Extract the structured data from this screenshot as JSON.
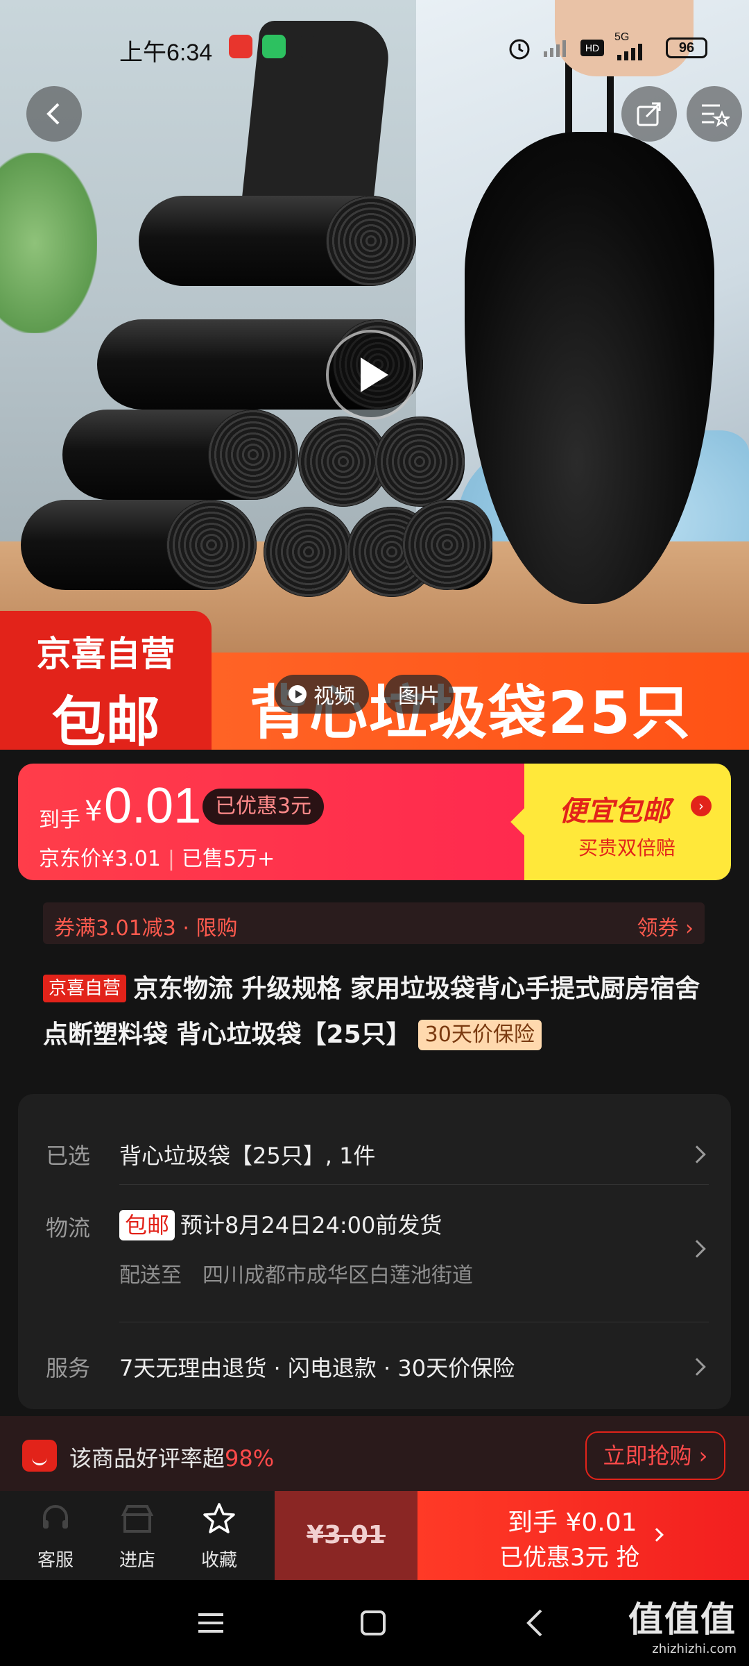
{
  "status_bar": {
    "time": "上午6:34",
    "network": "5G",
    "battery": "96"
  },
  "hero": {
    "badge_line1": "京喜自营",
    "badge_line2": "包邮",
    "banner_text": "背心垃圾袋25只",
    "tab_video": "视频",
    "tab_images": "图片"
  },
  "price": {
    "daoshou_label": "到手",
    "currency": "¥",
    "amount": "0.01",
    "saved": "已优惠3元",
    "jd_price": "京东价¥3.01",
    "sold": "已售5万+",
    "promo_title": "便宜包邮",
    "promo_sub": "买贵双倍赔"
  },
  "coupon": {
    "text": "券满3.01减3 · 限购",
    "action": "领券 ›"
  },
  "product": {
    "tag": "京喜自营",
    "title": "京东物流 升级规格 家用垃圾袋背心手提式厨房宿舍点断塑料袋 背心垃圾袋【25只】",
    "price_protect": "30天价保险"
  },
  "spec": {
    "selected_label": "已选",
    "selected_value": "背心垃圾袋【25只】, 1件",
    "logistics_label": "物流",
    "logistics_tag": "包邮",
    "logistics_value": "预计8月24日24:00前发货",
    "ship_to": "配送至　四川成都市成华区白莲池街道",
    "service_label": "服务",
    "service_value": "7天无理由退货 · 闪电退款 · 30天价保险"
  },
  "rating": {
    "text": "该商品好评率超",
    "percent": "98%",
    "buy_now": "立即抢购 ›"
  },
  "action_bar": {
    "service": "客服",
    "shop": "进店",
    "favorite": "收藏",
    "orig_price": "¥3.01",
    "grab_line1": "到手 ¥0.01",
    "grab_line2": "已优惠3元 抢"
  },
  "watermark": {
    "logo": "值值值",
    "url": "zhizhizhi.com"
  },
  "colors": {
    "jd_red": "#e2231a",
    "promo_yellow": "#ffe83a"
  }
}
